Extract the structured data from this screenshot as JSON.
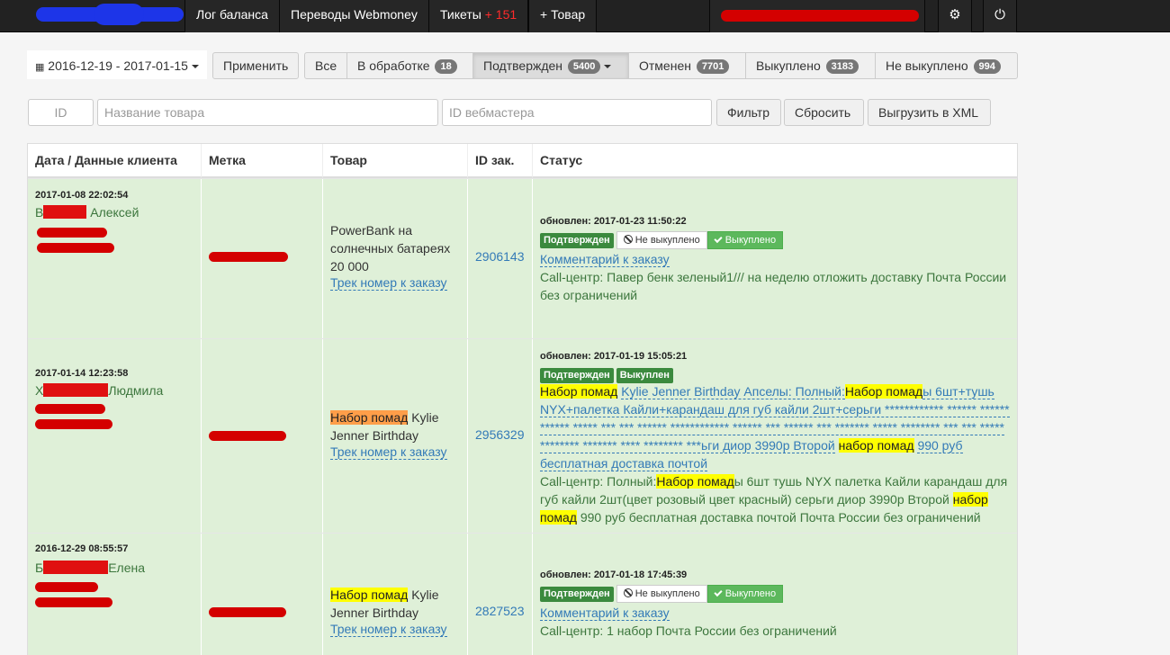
{
  "nav": {
    "items": [
      "Лог баланса",
      "Переводы Webmoney",
      "Тикеты",
      "+ Товар"
    ],
    "tickets_count": "+ 151",
    "settings_icon": "gear-icon",
    "logout_icon": "power-icon"
  },
  "toolbar": {
    "date_range": "2016-12-19 - 2017-01-15",
    "apply_label": "Применить",
    "filters": [
      {
        "label": "Все",
        "count": ""
      },
      {
        "label": "В обработке",
        "count": "18"
      },
      {
        "label": "Подтвержден",
        "count": "5400"
      },
      {
        "label": "Отменен",
        "count": "7701"
      },
      {
        "label": "Выкуплено",
        "count": "3183"
      },
      {
        "label": "Не выкуплено",
        "count": "994"
      }
    ]
  },
  "search": {
    "id_placeholder": "ID",
    "product_placeholder": "Название товара",
    "webmaster_placeholder": "ID вебмастера",
    "filter_label": "Фильтр",
    "reset_label": "Сбросить",
    "export_label": "Выгрузить в XML"
  },
  "table": {
    "headers": [
      "Дата / Данные клиента",
      "Метка",
      "Товар",
      "ID зак.",
      "Статус"
    ],
    "rows": [
      {
        "date": "2017-01-08 22:02:54",
        "client_initial": "В",
        "client_name": "Алексей",
        "product": "PowerBank на солнечных батареях 20 000",
        "track_link": "Трек номер к заказу",
        "order_id": "2906143",
        "updated": "обновлен: 2017-01-23 11:50:22",
        "status_label": "Подтвержден",
        "not_bought_btn": "Не выкуплено",
        "bought_btn": "Выкуплено",
        "comment_link": "Комментарий к заказу",
        "callcenter": "Call-центр: Павер бенк зеленый1/// на неделю отложить доставку Почта России без ограничений"
      },
      {
        "date": "2017-01-14 12:23:58",
        "client_initial": "Х",
        "client_name": "Людмила",
        "product_hl": "Набор помад",
        "product_rest": "Kylie Jenner Birthday",
        "track_link": "Трек номер к заказу",
        "order_id": "2956329",
        "updated": "обновлен: 2017-01-19 15:05:21",
        "status_label": "Подтвержден",
        "status_label2": "Выкуплен",
        "comment_hl1": "Набор помад",
        "comment_t1": "Kylie Jenner Birthday Апселы: Полный:",
        "comment_hl2": "Набор помад",
        "comment_t2": "ы 6шт+тушь NYX+палетка Кайли+карандаш для губ кайли 2шт+серьги ************ ****** ****** ****** ***** *** *** ****** ************ ****** *** ****** *** ******* ***** ******** *** *** ***** ******** ******* **** ******** ***ьги диор 3990р Второй",
        "comment_hl3": "набор помад",
        "comment_t3": "990 руб бесплатная доставка почтой",
        "cc_t1": "Call-центр: Полный:",
        "cc_hl1": "Набор помад",
        "cc_t2": "ы 6шт тушь NYX палетка Кайли карандаш для губ кайли 2шт(цвет розовый цвет красный) серьги диор 3990р Второй",
        "cc_hl2": "набор помад",
        "cc_t3": "990 руб бесплатная доставка почтой Почта России без ограничений"
      },
      {
        "date": "2016-12-29 08:55:57",
        "client_initial": "Б",
        "client_name": "Елена",
        "product_hl": "Набор помад",
        "product_rest": "Kylie Jenner Birthday",
        "track_link": "Трек номер к заказу",
        "order_id": "2827523",
        "updated": "обновлен: 2017-01-18 17:45:39",
        "status_label": "Подтвержден",
        "not_bought_btn": "Не выкуплено",
        "bought_btn": "Выкуплено",
        "comment_link": "Комментарий к заказу",
        "callcenter": "Call-центр: 1 набор Почта России без ограничений"
      }
    ]
  }
}
